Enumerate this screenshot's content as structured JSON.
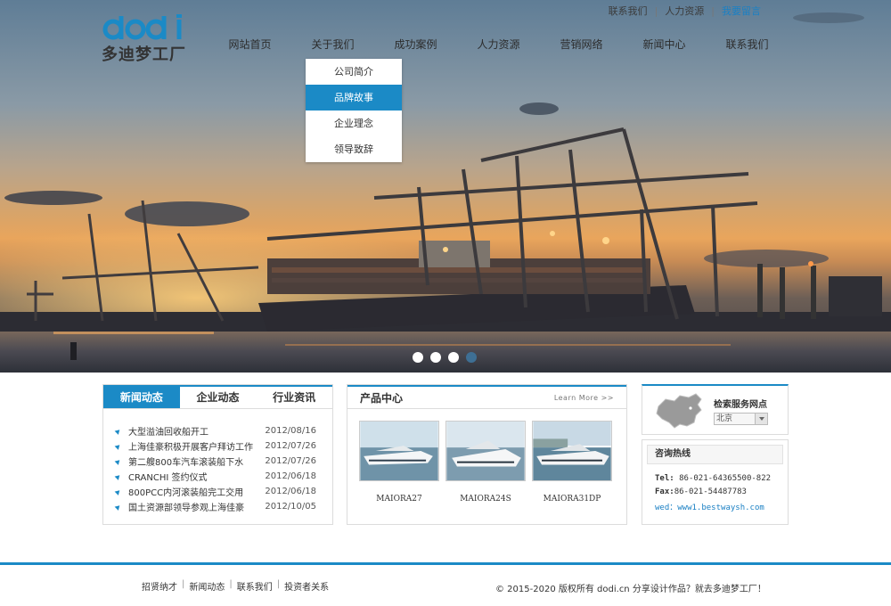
{
  "topbar": {
    "links": [
      "联系我们",
      "人力资源",
      "我要留言"
    ]
  },
  "logo": {
    "mark": "dodi",
    "text": "多迪梦工厂"
  },
  "nav": {
    "items": [
      "网站首页",
      "关于我们",
      "成功案例",
      "人力资源",
      "营销网络",
      "新闻中心",
      "联系我们"
    ]
  },
  "dropdown": {
    "items": [
      "公司简介",
      "品牌故事",
      "企业理念",
      "领导致辞"
    ],
    "active_index": 1
  },
  "slider": {
    "dot_count": 4,
    "active_index": 3
  },
  "news": {
    "tabs": [
      "新闻动态",
      "企业动态",
      "行业资讯"
    ],
    "active_tab": 0,
    "items": [
      {
        "title": "大型溢油回收船开工",
        "date": "2012/08/16"
      },
      {
        "title": "上海佳豪积极开展客户拜访工作",
        "date": "2012/07/26"
      },
      {
        "title": "第二艘800车汽车滚装船下水",
        "date": "2012/07/26"
      },
      {
        "title": "CRANCHI 签约仪式",
        "date": "2012/06/18"
      },
      {
        "title": "800PCC内河滚装船完工交用",
        "date": "2012/06/18"
      },
      {
        "title": "国土资源部领导参观上海佳豪",
        "date": "2012/10/05"
      }
    ]
  },
  "products": {
    "title": "产品中心",
    "more": "Learn More >>",
    "items": [
      "MAIORA27",
      "MAIORA24S",
      "MAIORA31DP"
    ]
  },
  "service": {
    "title": "检索服务网点",
    "city": "北京"
  },
  "hotline": {
    "title": "咨询热线",
    "tel_label": "Tel:",
    "tel": "86-021-64365500-822",
    "fax_label": "Fax:",
    "fax": "86-021-54487783",
    "web": "wed：www1.bestwaysh.com"
  },
  "footer": {
    "links": [
      "招贤纳才",
      "新闻动态",
      "联系我们",
      "投资者关系"
    ],
    "copyright": "© 2015-2020 版权所有 dodi.cn 分享设计作品？就去多迪梦工厂！"
  },
  "colors": {
    "accent": "#1b8ac6",
    "link": "#1b80c4",
    "dot_active": "#3e6f94"
  }
}
